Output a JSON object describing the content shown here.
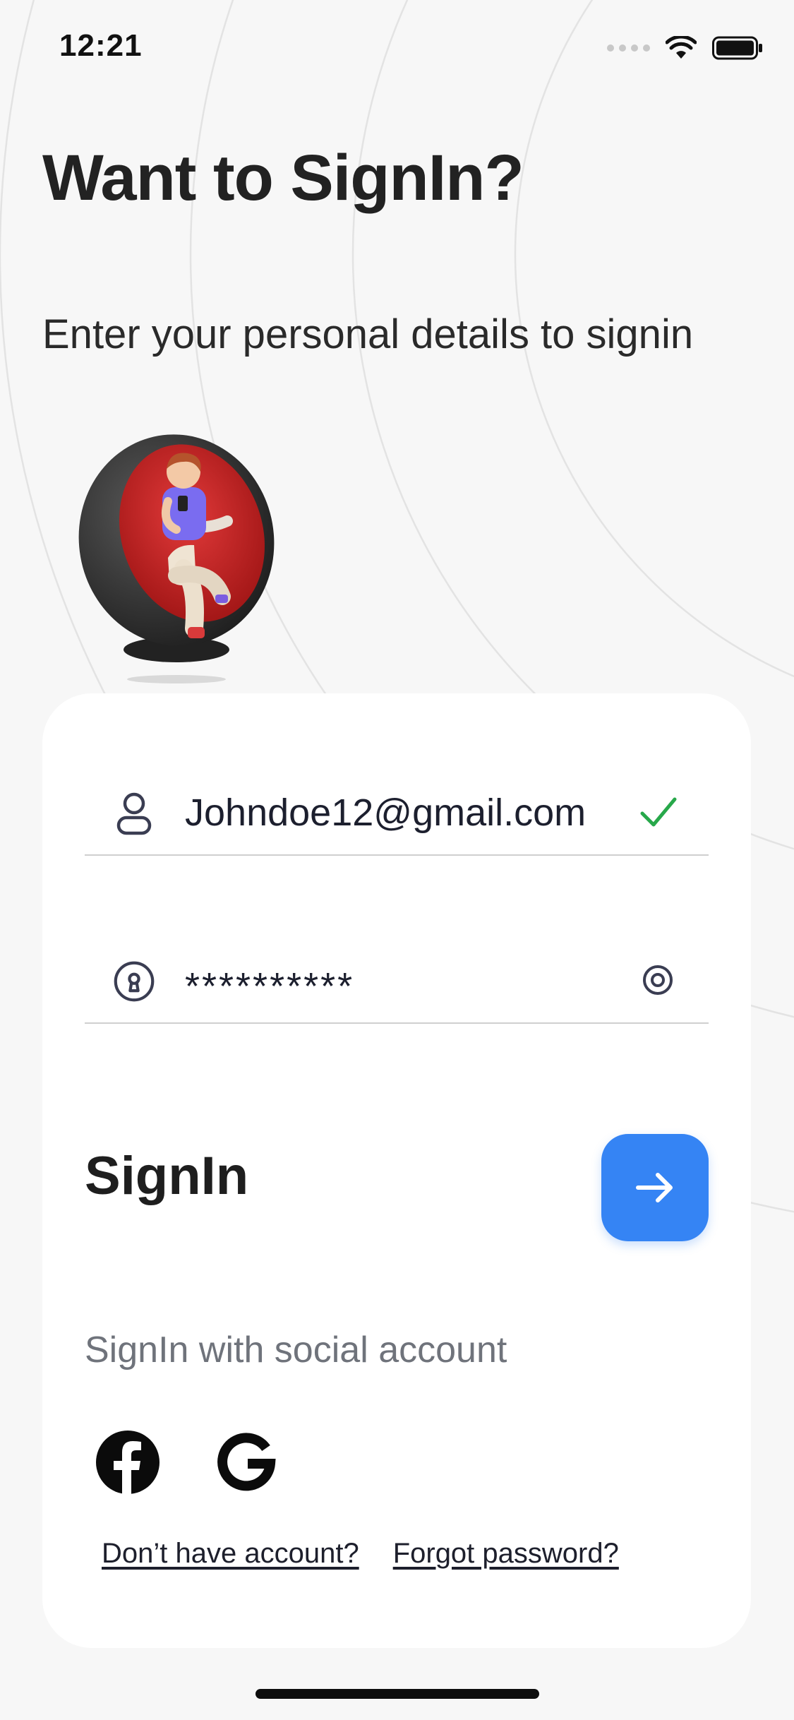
{
  "status_bar": {
    "time": "12:21",
    "signal_icon": "signal-icon",
    "wifi_icon": "wifi-icon",
    "battery_icon": "battery-icon"
  },
  "header": {
    "title": "Want to SignIn?",
    "subtitle": "Enter your personal details to signin"
  },
  "illustration": {
    "icon": "person-in-egg-chair-illustration"
  },
  "form": {
    "email": {
      "value": "Johndoe12@gmail.com",
      "leading_icon": "user-icon",
      "trailing_icon": "check-icon"
    },
    "password": {
      "value": "**********",
      "leading_icon": "lock-icon",
      "trailing_icon": "eye-icon"
    }
  },
  "signin": {
    "label": "SignIn",
    "button_icon": "arrow-right-icon"
  },
  "social": {
    "label": "SignIn with social account",
    "providers": [
      "facebook-icon",
      "google-icon"
    ]
  },
  "links": {
    "no_account": "Don’t have account?",
    "forgot_password": "Forgot password?"
  },
  "colors": {
    "background": "#f7f7f7",
    "card": "#ffffff",
    "accent": "#3584f4",
    "success": "#27a84a",
    "muted_text": "#6f737b"
  }
}
